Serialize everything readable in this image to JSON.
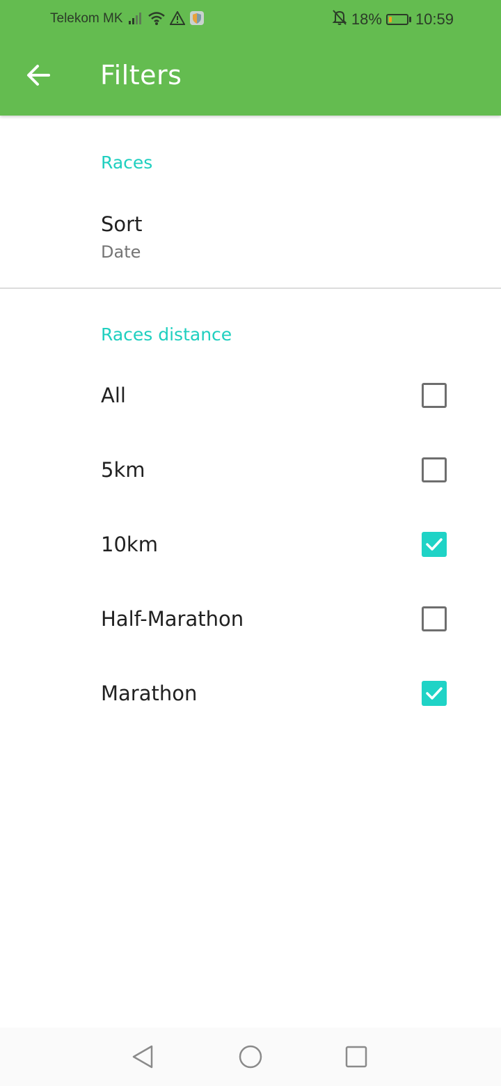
{
  "status_bar": {
    "carrier": "Telekom MK",
    "battery_percent": "18%",
    "battery_level": 0.18,
    "time": "10:59",
    "icons": [
      "signal-icon",
      "wifi-icon",
      "warning-icon",
      "shield-app-icon",
      "bell-off-icon",
      "battery-icon"
    ],
    "battery_color": "#f0a020"
  },
  "app_bar": {
    "title": "Filters",
    "back_icon": "arrow-back-icon",
    "color": "#64bc50"
  },
  "races_section": {
    "header": "Races",
    "sort": {
      "title": "Sort",
      "summary": "Date"
    }
  },
  "distance_section": {
    "header": "Races distance",
    "options": [
      {
        "label": "All",
        "checked": false
      },
      {
        "label": "5km",
        "checked": false
      },
      {
        "label": "10km",
        "checked": true
      },
      {
        "label": "Half-Marathon",
        "checked": false
      },
      {
        "label": "Marathon",
        "checked": true
      }
    ]
  },
  "colors": {
    "accent": "#1fcfbf",
    "checkbox_checked": "#1fd3c6"
  },
  "nav_bar": {
    "icons": [
      "back-triangle-icon",
      "home-circle-icon",
      "recents-square-icon"
    ]
  }
}
